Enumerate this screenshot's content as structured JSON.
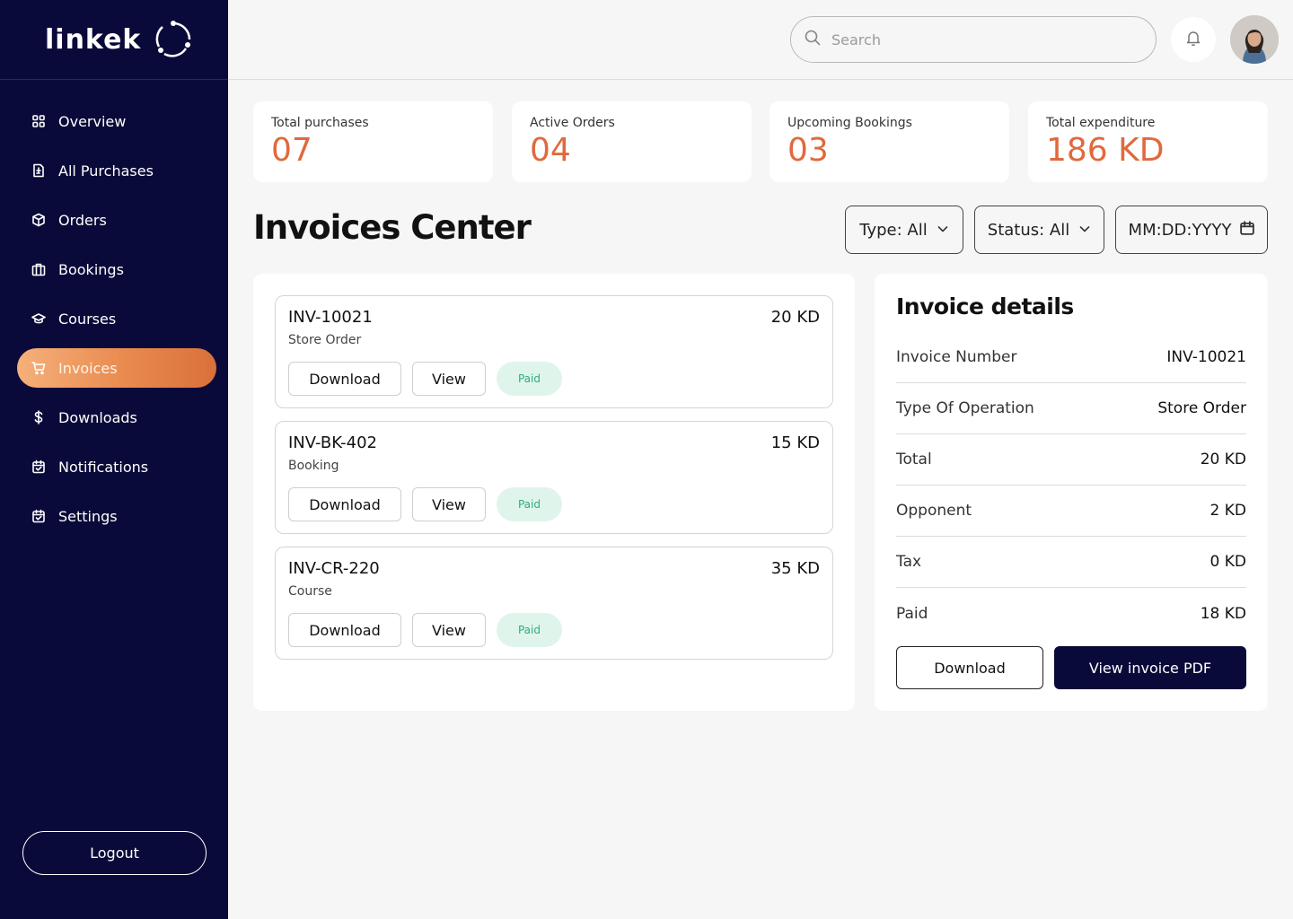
{
  "brand": {
    "name": "linkek"
  },
  "colors": {
    "sidebar": "#0a0a3a",
    "accent": "#e0693d",
    "paid": "#2fae78"
  },
  "sidebar": {
    "items": [
      {
        "label": "Overview",
        "icon": "grid-icon"
      },
      {
        "label": "All Purchases",
        "icon": "receipt-icon"
      },
      {
        "label": "Orders",
        "icon": "box-icon"
      },
      {
        "label": "Bookings",
        "icon": "briefcase-icon"
      },
      {
        "label": "Courses",
        "icon": "graduation-cap-icon"
      },
      {
        "label": "Invoices",
        "icon": "cart-icon",
        "active": true
      },
      {
        "label": "Downloads",
        "icon": "dollar-icon"
      },
      {
        "label": "Notifications",
        "icon": "calendar-icon"
      },
      {
        "label": "Settings",
        "icon": "calendar-icon"
      }
    ],
    "logout_label": "Logout"
  },
  "header": {
    "search_placeholder": "Search"
  },
  "stats": [
    {
      "label": "Total purchases",
      "value": "07"
    },
    {
      "label": "Active Orders",
      "value": "04"
    },
    {
      "label": "Upcoming Bookings",
      "value": "03"
    },
    {
      "label": "Total expenditure",
      "value": "186 KD"
    }
  ],
  "page": {
    "title": "Invoices Center",
    "filters": {
      "type": "Type: All",
      "status": "Status: All",
      "date": "MM:DD:YYYY"
    }
  },
  "invoices": [
    {
      "id": "INV-10021",
      "type": "Store Order",
      "amount": "20 KD",
      "status": "Paid",
      "download": "Download",
      "view": "View"
    },
    {
      "id": "INV-BK-402",
      "type": "Booking",
      "amount": "15 KD",
      "status": "Paid",
      "download": "Download",
      "view": "View"
    },
    {
      "id": "INV-CR-220",
      "type": "Course",
      "amount": "35 KD",
      "status": "Paid",
      "download": "Download",
      "view": "View"
    }
  ],
  "details": {
    "title": "Invoice details",
    "rows": [
      {
        "label": "Invoice Number",
        "value": "INV-10021"
      },
      {
        "label": "Type Of Operation",
        "value": "Store Order"
      },
      {
        "label": "Total",
        "value": "20 KD"
      },
      {
        "label": "Opponent",
        "value": "2 KD"
      },
      {
        "label": "Tax",
        "value": "0 KD"
      },
      {
        "label": "Paid",
        "value": "18 KD"
      }
    ],
    "download_label": "Download",
    "view_pdf_label": "View invoice PDF"
  }
}
